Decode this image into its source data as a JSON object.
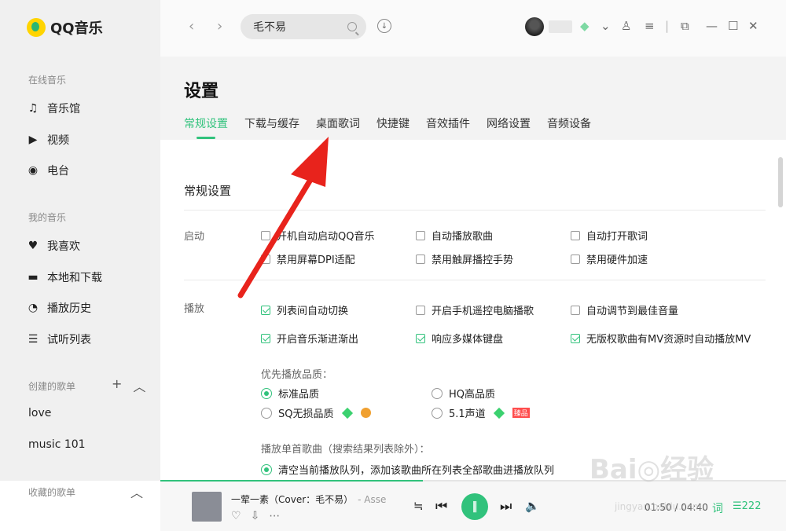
{
  "app": {
    "logo_text": "QQ音乐"
  },
  "sidebar": {
    "online_title": "在线音乐",
    "online_items": [
      {
        "label": "音乐馆",
        "icon": "music-note-icon"
      },
      {
        "label": "视频",
        "icon": "video-icon"
      },
      {
        "label": "电台",
        "icon": "radio-icon"
      }
    ],
    "my_title": "我的音乐",
    "my_items": [
      {
        "label": "我喜欢",
        "icon": "heart-icon"
      },
      {
        "label": "本地和下载",
        "icon": "monitor-icon"
      },
      {
        "label": "播放历史",
        "icon": "clock-icon"
      },
      {
        "label": "试听列表",
        "icon": "playlist-icon"
      }
    ],
    "created_title": "创建的歌单",
    "created_playlists": [
      "love",
      "music 101"
    ],
    "collected_title": "收藏的歌单"
  },
  "topbar": {
    "search_value": "毛不易"
  },
  "settings": {
    "title": "设置",
    "tabs": [
      "常规设置",
      "下载与缓存",
      "桌面歌词",
      "快捷键",
      "音效插件",
      "网络设置",
      "音频设备"
    ],
    "active_tab": 0,
    "section_title": "常规设置",
    "startup_label": "启动",
    "startup_options": [
      {
        "label": "开机自动启动QQ音乐",
        "checked": false
      },
      {
        "label": "自动播放歌曲",
        "checked": false
      },
      {
        "label": "自动打开歌词",
        "checked": false
      },
      {
        "label": "禁用屏幕DPI适配",
        "checked": false
      },
      {
        "label": "禁用触屏播控手势",
        "checked": false
      },
      {
        "label": "禁用硬件加速",
        "checked": false
      }
    ],
    "play_label": "播放",
    "play_options": [
      {
        "label": "列表间自动切换",
        "checked": true
      },
      {
        "label": "开启手机遥控电脑播歌",
        "checked": false
      },
      {
        "label": "自动调节到最佳音量",
        "checked": false
      },
      {
        "label": "开启音乐渐进渐出",
        "checked": true
      },
      {
        "label": "响应多媒体键盘",
        "checked": true
      },
      {
        "label": "无版权歌曲有MV资源时自动播放MV",
        "checked": true
      }
    ],
    "quality_label": "优先播放品质：",
    "quality_options": [
      {
        "label": "标准品质",
        "selected": true
      },
      {
        "label": "HQ高品质",
        "selected": false
      },
      {
        "label": "SQ无损品质",
        "selected": false
      },
      {
        "label": "5.1声道",
        "selected": false
      }
    ],
    "quality_badge_tag": "臻品",
    "single_label": "播放单首歌曲（搜索结果列表除外）：",
    "single_option": "清空当前播放队列，添加该歌曲所在列表全部歌曲进播放队列"
  },
  "player": {
    "title": "一荤一素（Cover：毛不易）",
    "artist": "- Asse",
    "time": "01:50 / 04:40",
    "lyric_label": "词",
    "queue_count": "222",
    "progress": 0.42
  },
  "watermark": {
    "main": "Bai◎经验",
    "sub": "jingyan.baidu.com"
  },
  "colors": {
    "accent": "#31c27c",
    "annotation": "#e8231c"
  }
}
